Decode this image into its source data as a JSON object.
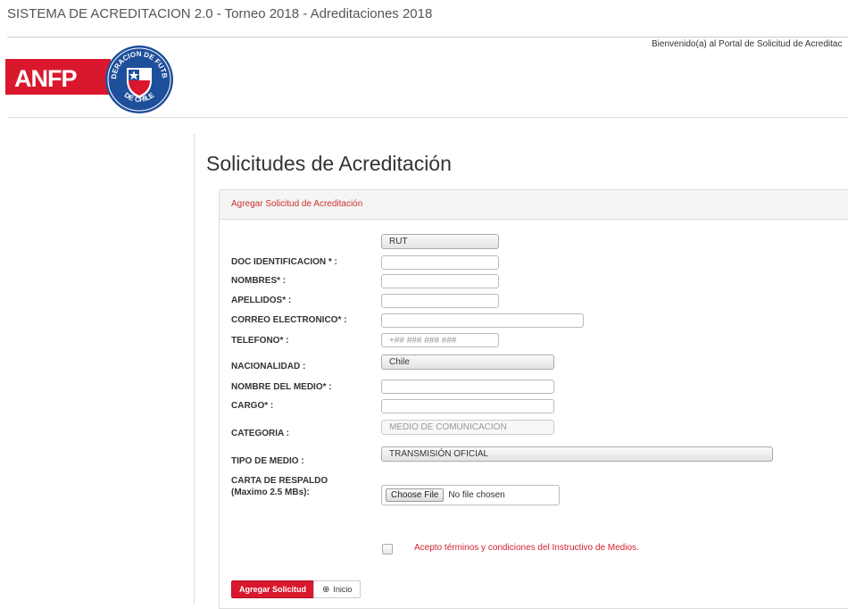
{
  "header": {
    "app_title": "SISTEMA DE ACREDITACION 2.0 - Torneo 2018 - Adreditaciones 2018",
    "welcome": "Bienvenido(a) al Portal de Solicitud de Acreditac",
    "logo": {
      "brand_text": "ANFP",
      "seal_top": "FEDERACION DE FUTBOL",
      "seal_bottom": "DE CHILE",
      "brand_color": "#d9182d",
      "seal_blue": "#1e4f9b"
    }
  },
  "page": {
    "title": "Solicitudes de Acreditación"
  },
  "panel": {
    "heading": "Agregar Solicitud de Acreditación"
  },
  "form": {
    "doc_type": "RUT",
    "doc_label": "DOC IDENTIFICACION * :",
    "nombres_label": "NOMBRES* :",
    "apellidos_label": "APELLIDOS* :",
    "correo_label": "CORREO ELECTRONICO* :",
    "telefono_label": "TELEFONO* :",
    "telefono_placeholder": "+## ### ### ###",
    "nacionalidad_label": "NACIONALIDAD :",
    "nacionalidad_value": "Chile",
    "medio_label": "NOMBRE DEL MEDIO* :",
    "cargo_label": "CARGO* :",
    "categoria_label": "CATEGORIA :",
    "categoria_value": "MEDIO DE COMUNICACION",
    "tipo_label": "TIPO DE MEDIO :",
    "tipo_value": "TRANSMISIÓN OFICIAL",
    "carta_label_1": "CARTA DE RESPALDO",
    "carta_label_2": "(Maximo 2.5 MBs):",
    "file_button": "Choose File",
    "file_status": "No file chosen",
    "terms": "Acepto términos y condiciones del Instructivo de Medios."
  },
  "actions": {
    "submit": "Agregar Solicitud",
    "home": "Inicio",
    "home_icon": "circle-plus-icon",
    "accent": "#d9182d"
  }
}
